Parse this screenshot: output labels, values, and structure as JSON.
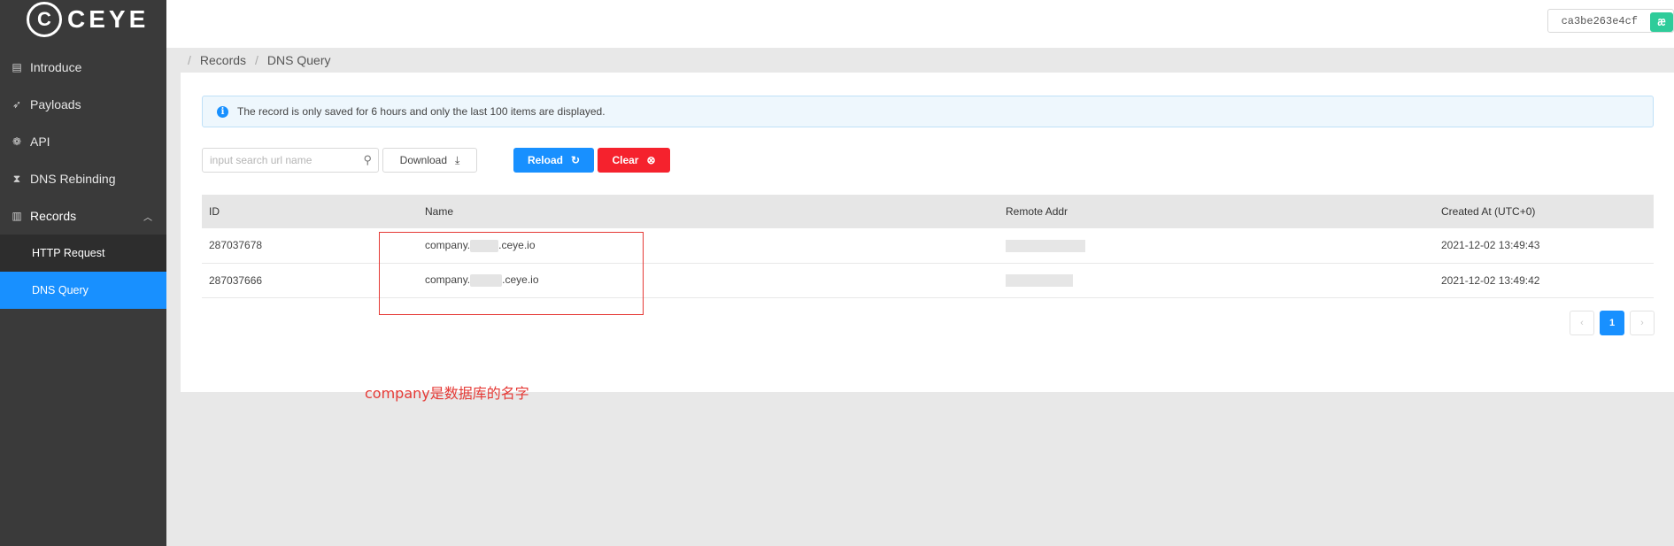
{
  "app": {
    "logo_mark": "C",
    "logo_text": "CEYE"
  },
  "sidebar": {
    "items": [
      {
        "label": "Introduce",
        "icon": "document-icon"
      },
      {
        "label": "Payloads",
        "icon": "rocket-icon"
      },
      {
        "label": "API",
        "icon": "api-icon"
      },
      {
        "label": "DNS Rebinding",
        "icon": "hourglass-icon"
      },
      {
        "label": "Records",
        "icon": "records-icon"
      }
    ],
    "sub_items": [
      {
        "label": "HTTP Request"
      },
      {
        "label": "DNS Query"
      }
    ]
  },
  "topbar": {
    "token": "ca3be263e4cf",
    "badge": "æ"
  },
  "breadcrumb": {
    "items": [
      "Records",
      "DNS Query"
    ]
  },
  "notice": {
    "icon": "info-icon",
    "text": "The record is only saved for 6 hours and only the last 100 items are displayed."
  },
  "toolbar": {
    "search_placeholder": "input search url name",
    "download_label": "Download",
    "reload_label": "Reload",
    "clear_label": "Clear"
  },
  "table": {
    "headers": [
      "ID",
      "Name",
      "Remote Addr",
      "Created At (UTC+0)"
    ],
    "rows": [
      {
        "id": "287037678",
        "name_prefix": "company.",
        "name_suffix": ".ceye.io",
        "created": "2021-12-02 13:49:43"
      },
      {
        "id": "287037666",
        "name_prefix": "company.",
        "name_suffix": ".ceye.io",
        "created": "2021-12-02 13:49:42"
      }
    ]
  },
  "pagination": {
    "prev": "‹",
    "current": "1",
    "next": "›"
  },
  "annotation": {
    "text": "company是数据库的名字",
    "color": "#e53935"
  },
  "colors": {
    "primary": "#1890ff",
    "danger": "#f5222d",
    "sidebar": "#3a3a3a"
  }
}
